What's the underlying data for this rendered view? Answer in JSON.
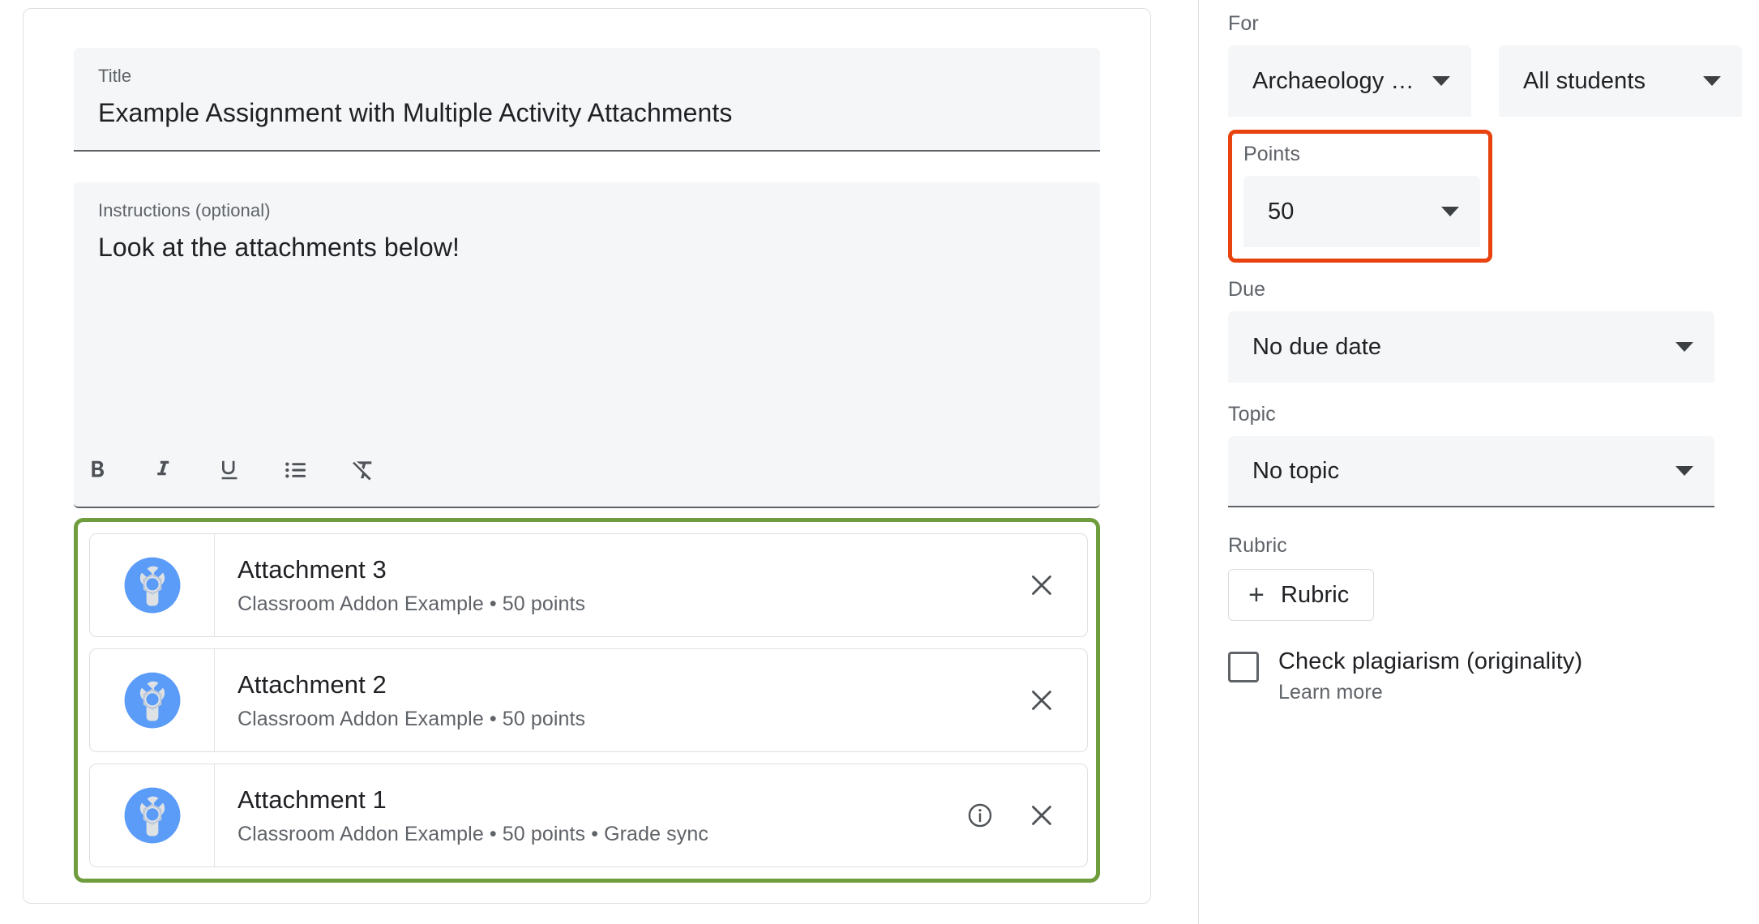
{
  "editor": {
    "title_field": {
      "label": "Title",
      "value": "Example Assignment with Multiple Activity Attachments"
    },
    "instructions_field": {
      "label": "Instructions (optional)",
      "value": "Look at the attachments below!"
    },
    "toolbar": [
      {
        "name": "bold-icon",
        "label": "B"
      },
      {
        "name": "italic-icon",
        "label": "I"
      },
      {
        "name": "underline-icon",
        "label": "U"
      },
      {
        "name": "bulleted-list-icon",
        "label": "List"
      },
      {
        "name": "clear-formatting-icon",
        "label": "Clear formatting"
      }
    ],
    "attachments": [
      {
        "title": "Attachment 3",
        "subtitle": "Classroom Addon Example • 50 points",
        "icon": "classroom-addon-icon",
        "has_info": false,
        "close_label": "×"
      },
      {
        "title": "Attachment 2",
        "subtitle": "Classroom Addon Example • 50 points",
        "icon": "classroom-addon-icon",
        "has_info": false,
        "close_label": "×"
      },
      {
        "title": "Attachment 1",
        "subtitle": "Classroom Addon Example • 50 points • Grade sync",
        "icon": "classroom-addon-icon",
        "has_info": true,
        "close_label": "×"
      }
    ]
  },
  "settings": {
    "for": {
      "label": "For",
      "course": "Archaeology …",
      "audience": "All students"
    },
    "points": {
      "label": "Points",
      "value": "50"
    },
    "due": {
      "label": "Due",
      "value": "No due date"
    },
    "topic": {
      "label": "Topic",
      "value": "No topic"
    },
    "rubric": {
      "label": "Rubric",
      "button_label": "Rubric",
      "plus": "+"
    },
    "plagiarism": {
      "label": "Check plagiarism (originality)",
      "learn_more": "Learn more",
      "checked": false
    }
  },
  "highlights": {
    "points_color": "#e8430f",
    "attachments_color": "#6f9c3d"
  }
}
